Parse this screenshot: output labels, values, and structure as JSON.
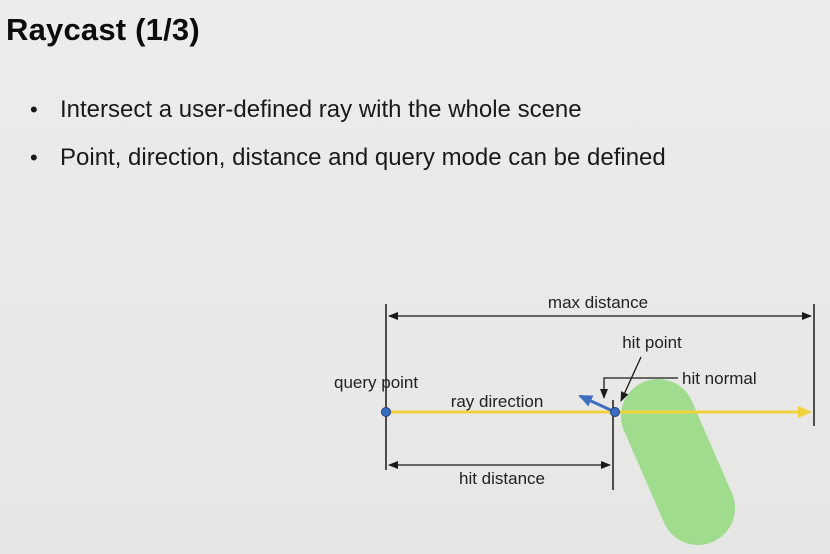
{
  "slide": {
    "title": "Raycast (1/3)",
    "bullets": [
      "Intersect a user-defined ray with the whole scene",
      "Point, direction, distance and query mode can be defined"
    ]
  },
  "diagram": {
    "labels": {
      "max_distance": "max distance",
      "hit_point": "hit point",
      "hit_normal": "hit normal",
      "query_point": "query point",
      "ray_direction": "ray direction",
      "hit_distance": "hit distance"
    },
    "colors": {
      "ray": "#f0d23c",
      "normal": "#3f6fc0",
      "object": "#9fdc8e",
      "point": "#3b6cc4",
      "lines": "#1a1a1a"
    }
  }
}
